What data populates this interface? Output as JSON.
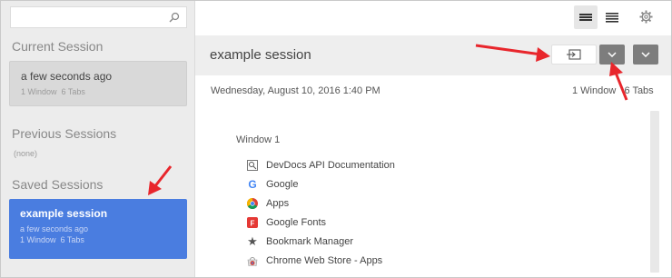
{
  "sidebar": {
    "search_placeholder": "",
    "current_heading": "Current Session",
    "current_card": {
      "title": "a few seconds ago",
      "windows": "1 Window",
      "tabs": "6 Tabs"
    },
    "previous_heading": "Previous Sessions",
    "previous_none": "(none)",
    "saved_heading": "Saved Sessions",
    "saved_card": {
      "title": "example session",
      "time": "a few seconds ago",
      "windows": "1 Window",
      "tabs": "6 Tabs"
    }
  },
  "toolbar": {
    "icons": [
      "list-compact-icon",
      "list-icon",
      "gear-icon"
    ]
  },
  "session": {
    "title": "example session",
    "date": "Wednesday, August 10, 2016 1:40 PM",
    "counts": "1 Window   6 Tabs",
    "window_label": "Window 1",
    "tabs": [
      {
        "label": "DevDocs API Documentation",
        "icon": "devdocs-icon"
      },
      {
        "label": "Google",
        "icon": "google-icon"
      },
      {
        "label": "Apps",
        "icon": "chrome-icon"
      },
      {
        "label": "Google Fonts",
        "icon": "google-fonts-icon"
      },
      {
        "label": "Bookmark Manager",
        "icon": "star-icon"
      },
      {
        "label": "Chrome Web Store - Apps",
        "icon": "webstore-icon"
      }
    ]
  },
  "colors": {
    "accent": "#4a7de0",
    "annotation": "#e8262c",
    "button_dark": "#7d7d7d"
  }
}
